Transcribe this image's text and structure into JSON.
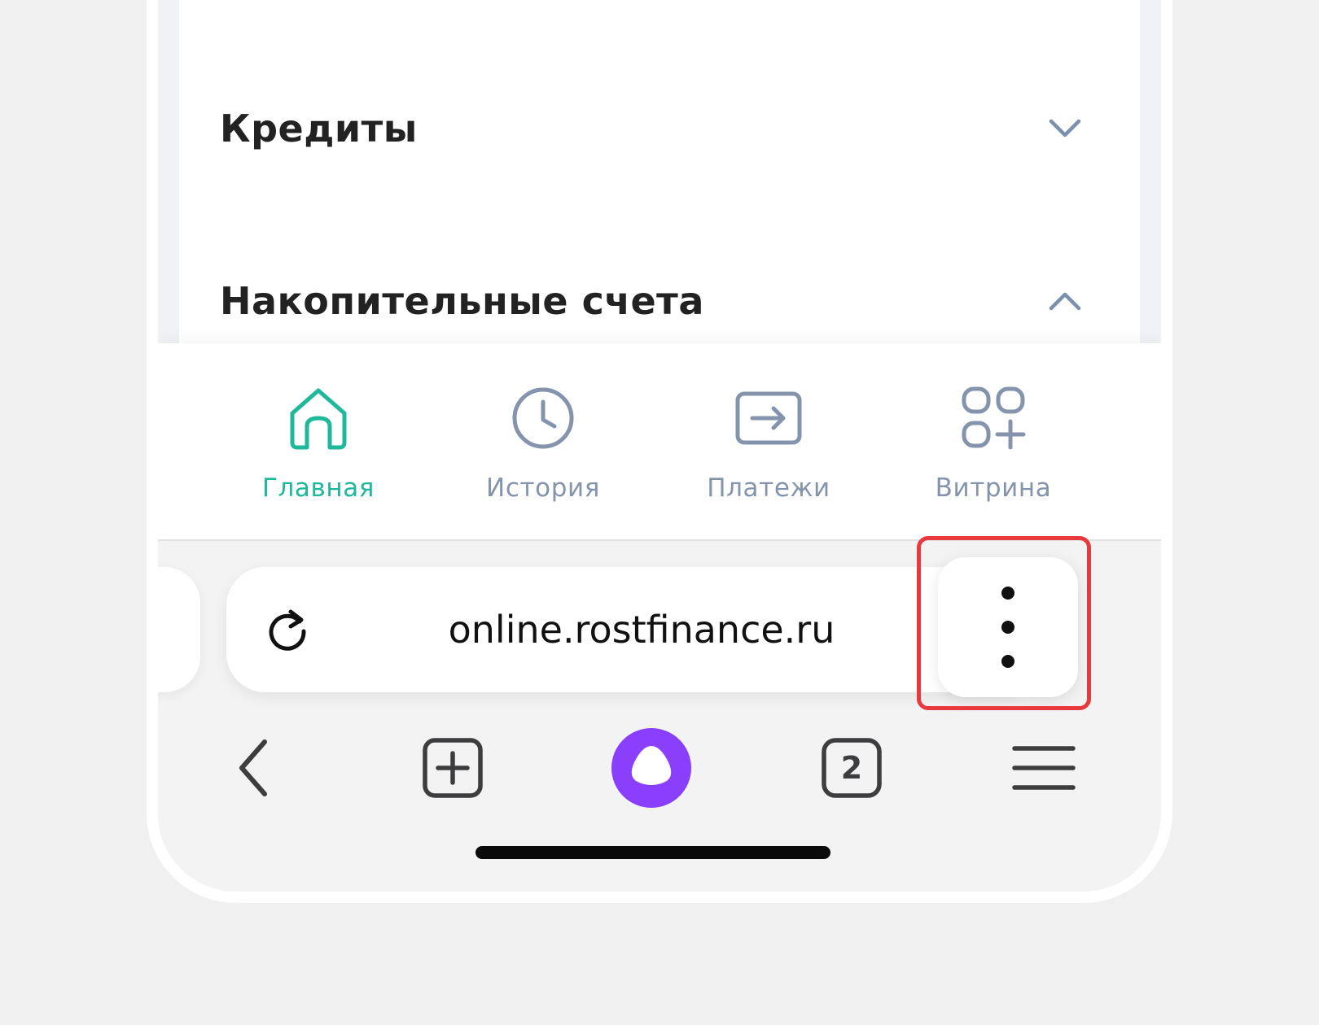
{
  "sections": [
    {
      "title": "Кредиты",
      "expanded": false,
      "chevron": "chevron-down-icon"
    },
    {
      "title": "Накопительные счета",
      "expanded": true,
      "chevron": "chevron-up-icon"
    }
  ],
  "app_nav": {
    "items": [
      {
        "label": "Главная",
        "icon": "home-icon",
        "active": true
      },
      {
        "label": "История",
        "icon": "clock-icon",
        "active": false
      },
      {
        "label": "Платежи",
        "icon": "transfer-arrow-icon",
        "active": false
      },
      {
        "label": "Витрина",
        "icon": "apps-grid-plus-icon",
        "active": false
      }
    ]
  },
  "browser": {
    "url": "online.rostfinance.ru",
    "tab_count": "2",
    "toolbar": [
      "back-icon",
      "new-tab-icon",
      "alice-assistant-icon",
      "tabs-icon",
      "menu-icon"
    ]
  },
  "colors": {
    "accent_active": "#1fb89a",
    "nav_inactive": "#8594ad",
    "assistant": "#8a3ffc",
    "highlight": "#e8393c"
  }
}
